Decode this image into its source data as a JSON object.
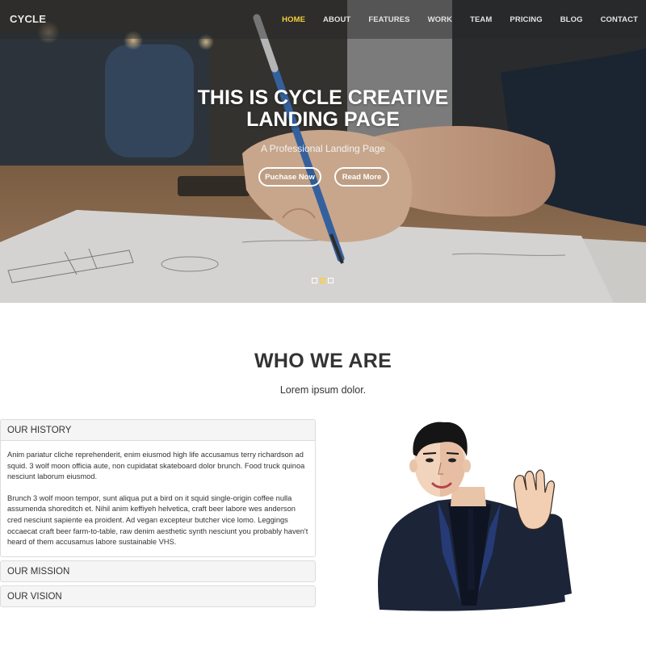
{
  "brand": "CYCLE",
  "nav": {
    "items": [
      "HOME",
      "ABOUT",
      "FEATURES",
      "WORK",
      "TEAM",
      "PRICING",
      "BLOG",
      "CONTACT"
    ],
    "active_index": 0
  },
  "hero": {
    "title_line1": "THIS IS CYCLE CREATIVE",
    "title_line2": "LANDING PAGE",
    "subtitle": "A Professional Landing Page",
    "purchase_label": "Puchase Now",
    "read_label": "Read More",
    "slide_count": 3,
    "active_slide": 1
  },
  "about": {
    "title": "WHO WE ARE",
    "subtitle": "Lorem ipsum dolor.",
    "panels": [
      {
        "title": "OUR HISTORY",
        "open": true,
        "paragraph1": "Anim pariatur cliche reprehenderit, enim eiusmod high life accusamus terry richardson ad squid. 3 wolf moon officia aute, non cupidatat skateboard dolor brunch. Food truck quinoa nesciunt laborum eiusmod.",
        "paragraph2": "Brunch 3 wolf moon tempor, sunt aliqua put a bird on it squid single-origin coffee nulla assumenda shoreditch et. Nihil anim keffiyeh helvetica, craft beer labore wes anderson cred nesciunt sapiente ea proident. Ad vegan excepteur butcher vice lomo. Leggings occaecat craft beer farm-to-table, raw denim aesthetic synth nesciunt you probably haven't heard of them accusamus labore sustainable VHS."
      },
      {
        "title": "OUR MISSION",
        "open": false
      },
      {
        "title": "OUR VISION",
        "open": false
      }
    ]
  },
  "colors": {
    "accent": "#f4d03f",
    "text": "#333333",
    "panel_bg": "#f5f5f5",
    "border": "#dddddd"
  },
  "icons": {
    "illustration": "waving-man-illustration",
    "slide_dot": "slide-dot-icon"
  }
}
